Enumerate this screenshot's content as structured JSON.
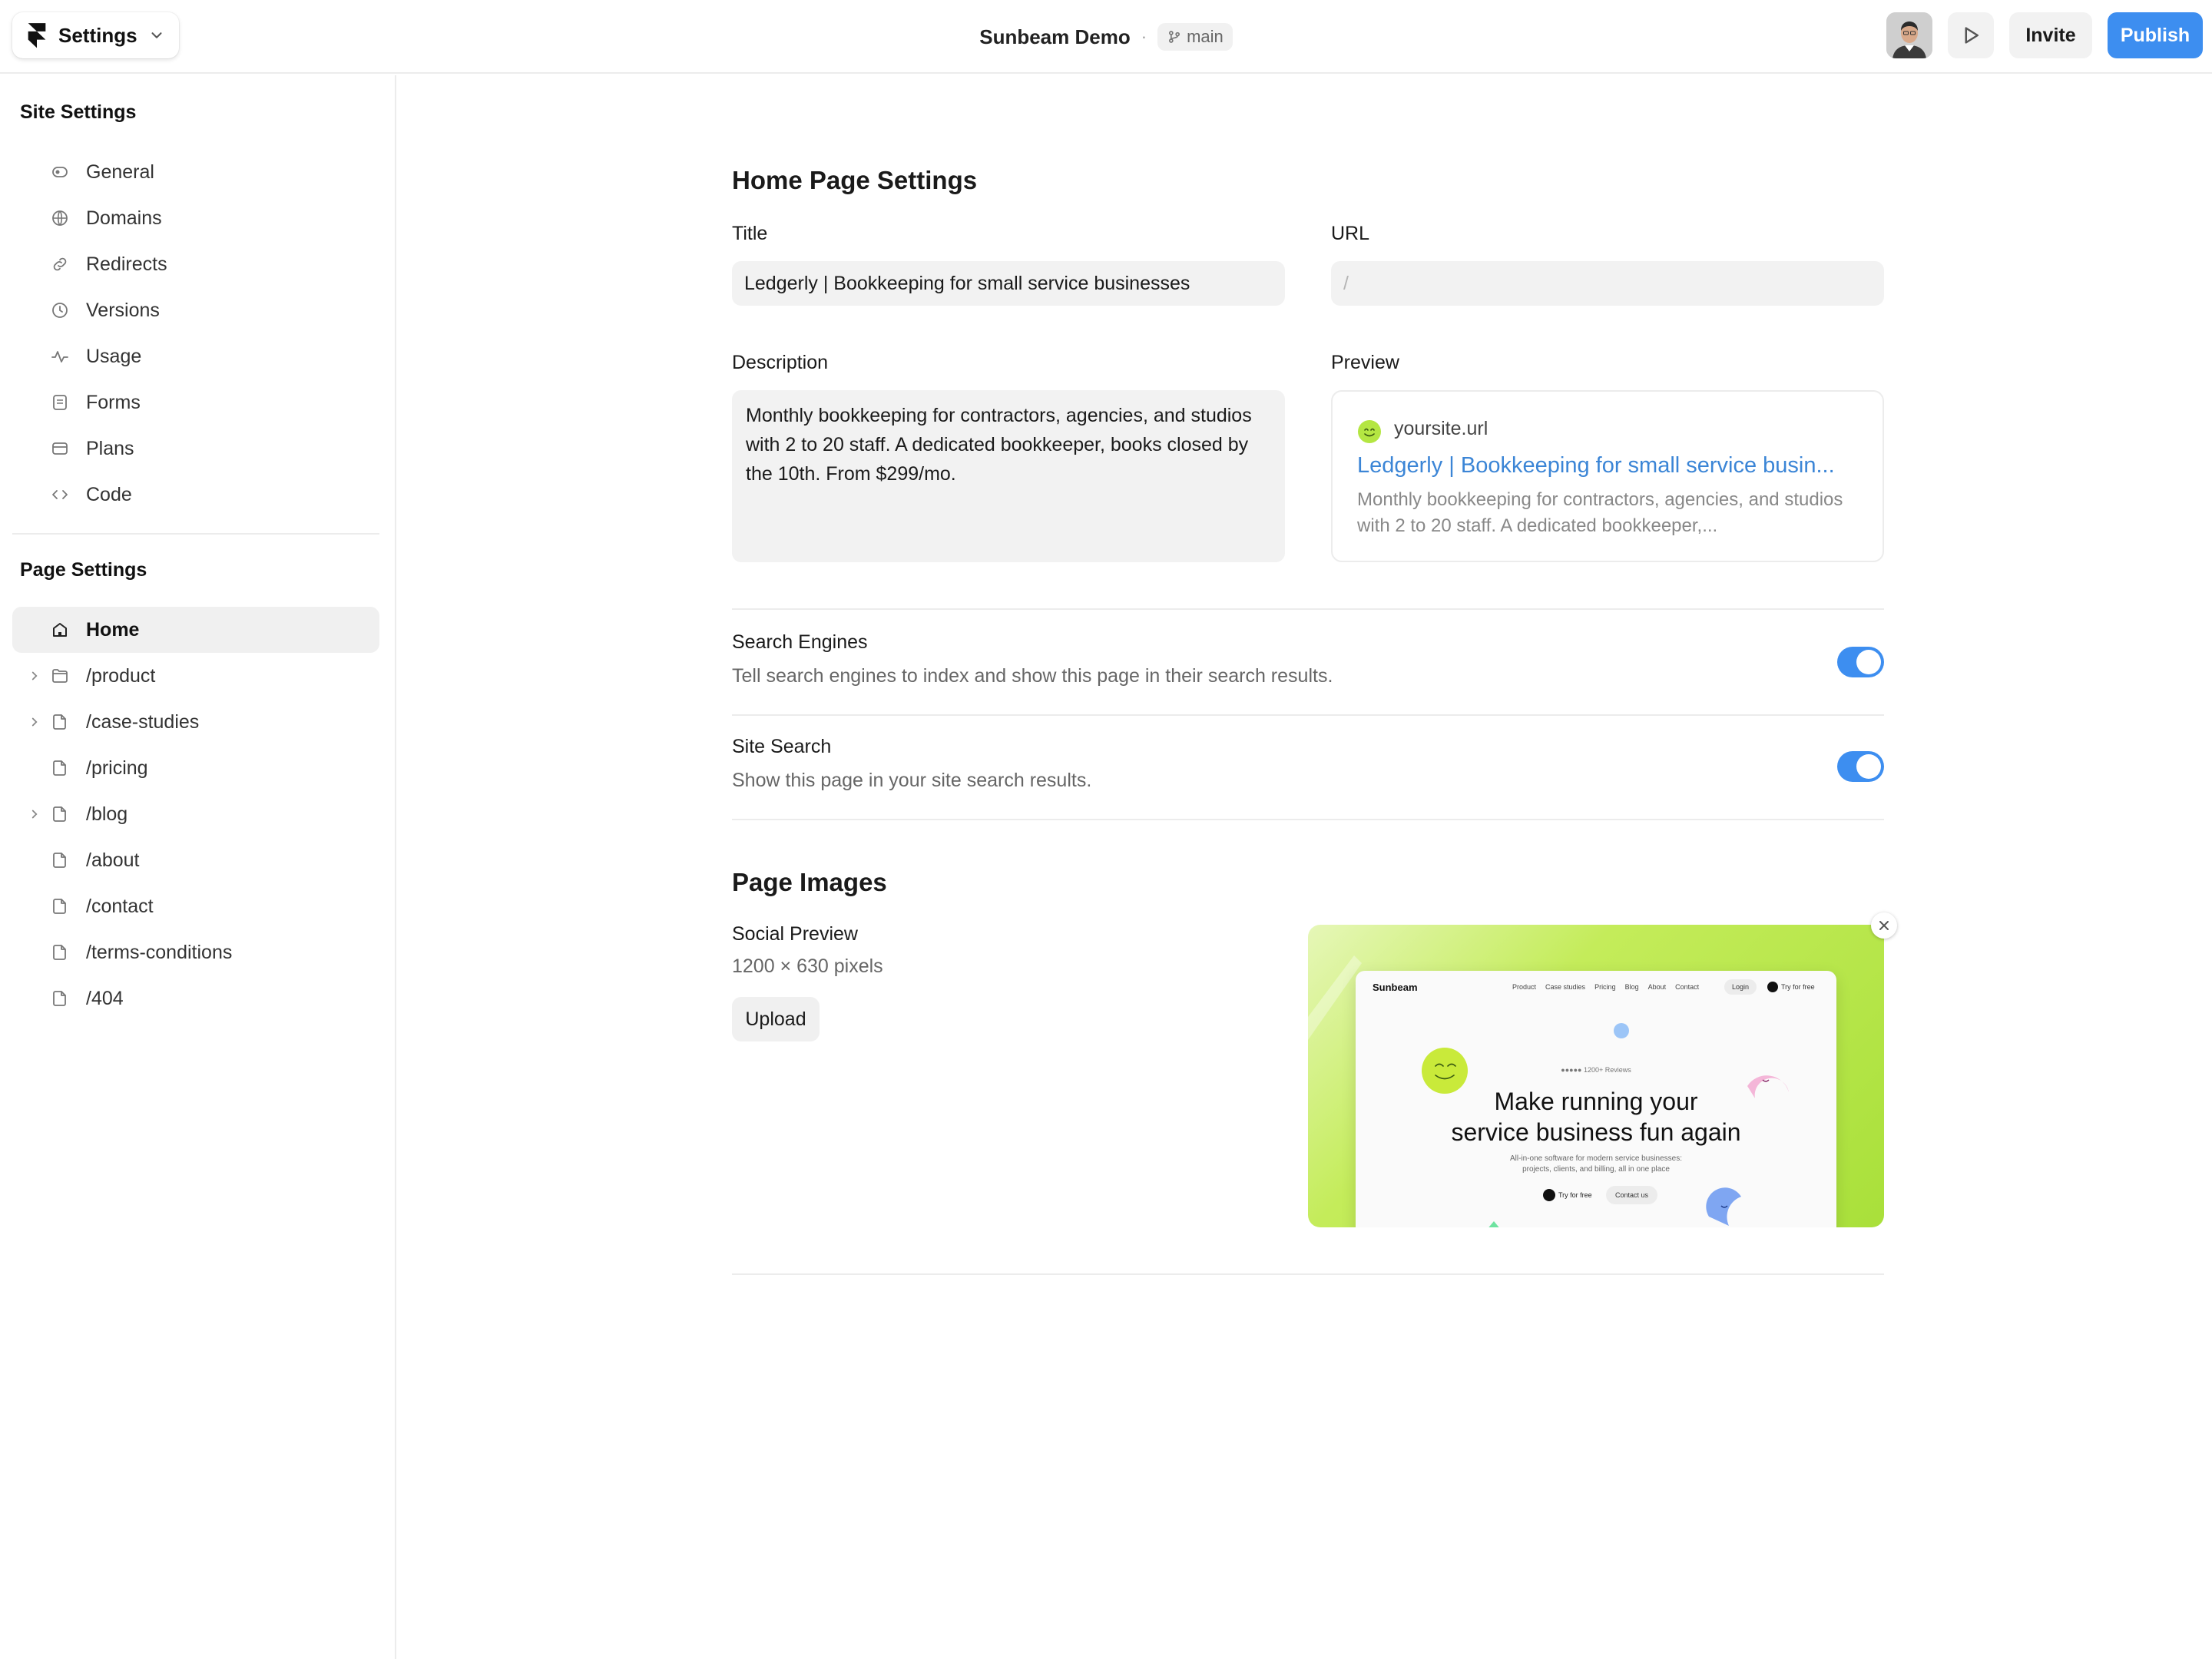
{
  "topbar": {
    "settings_label": "Settings",
    "project_name": "Sunbeam Demo",
    "separator": "·",
    "branch": "main",
    "invite_label": "Invite",
    "publish_label": "Publish"
  },
  "sidebar": {
    "site_settings_title": "Site Settings",
    "site_items": [
      {
        "label": "General",
        "icon": "general-icon"
      },
      {
        "label": "Domains",
        "icon": "globe-icon"
      },
      {
        "label": "Redirects",
        "icon": "link-icon"
      },
      {
        "label": "Versions",
        "icon": "clock-icon"
      },
      {
        "label": "Usage",
        "icon": "activity-icon"
      },
      {
        "label": "Forms",
        "icon": "form-icon"
      },
      {
        "label": "Plans",
        "icon": "card-icon"
      },
      {
        "label": "Code",
        "icon": "code-icon"
      }
    ],
    "page_settings_title": "Page Settings",
    "pages": [
      {
        "label": "Home",
        "icon": "home-icon",
        "active": true
      },
      {
        "label": "/product",
        "icon": "folder-icon",
        "expandable": true
      },
      {
        "label": "/case-studies",
        "icon": "page-icon",
        "expandable": true
      },
      {
        "label": "/pricing",
        "icon": "page-icon"
      },
      {
        "label": "/blog",
        "icon": "page-icon",
        "expandable": true
      },
      {
        "label": "/about",
        "icon": "page-icon"
      },
      {
        "label": "/contact",
        "icon": "page-icon"
      },
      {
        "label": "/terms-conditions",
        "icon": "page-icon"
      },
      {
        "label": "/404",
        "icon": "page-icon"
      }
    ]
  },
  "main": {
    "heading": "Home Page Settings",
    "title_label": "Title",
    "title_value": "Ledgerly | Bookkeeping for small service businesses",
    "url_label": "URL",
    "url_placeholder": "/",
    "description_label": "Description",
    "description_value": "Monthly bookkeeping for contractors, agencies, and studios with 2 to 20 staff. A dedicated bookkeeper, books closed by the 10th. From $299/mo.",
    "preview_label": "Preview",
    "preview": {
      "site": "yoursite.url",
      "title": "Ledgerly | Bookkeeping for small service busin...",
      "description": "Monthly bookkeeping for contractors, agencies, and studios with 2 to 20 staff. A dedicated bookkeeper,..."
    },
    "search_engines": {
      "title": "Search Engines",
      "description": "Tell search engines to index and show this page in their search results.",
      "enabled": true
    },
    "site_search": {
      "title": "Site Search",
      "description": "Show this page in your site search results.",
      "enabled": true
    },
    "page_images_heading": "Page Images",
    "social_preview": {
      "label": "Social Preview",
      "size": "1200 × 630 pixels",
      "upload_label": "Upload",
      "image": {
        "brand": "Sunbeam",
        "nav": [
          "Product",
          "Case studies",
          "Pricing",
          "Blog",
          "About",
          "Contact"
        ],
        "login": "Login",
        "try": "Try for free",
        "reviews": "●●●●● 1200+ Reviews",
        "hero_line1": "Make running your",
        "hero_line2": "service business fun again",
        "sub_line1": "All-in-one software for modern service businesses:",
        "sub_line2": "projects, clients, and billing, all in one place",
        "cta_primary": "Try for free",
        "cta_secondary": "Contact us"
      }
    }
  },
  "colors": {
    "accent": "#3d8ef0",
    "link": "#3b85d6",
    "preview_green": "#b4e642"
  }
}
